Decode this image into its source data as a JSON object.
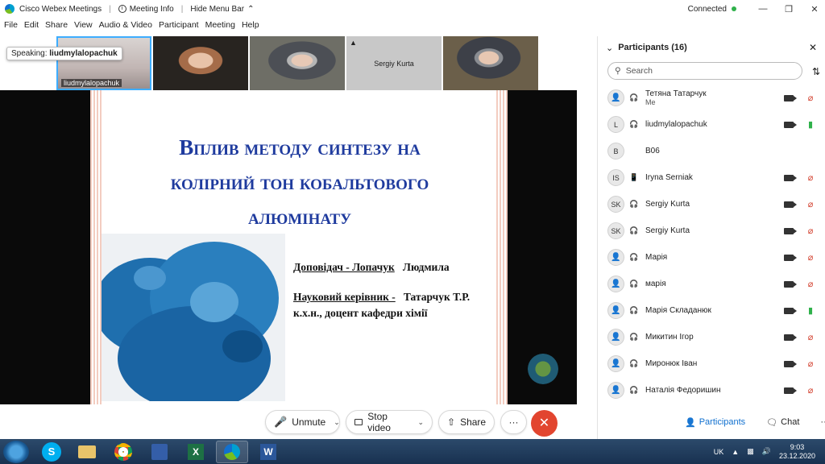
{
  "titlebar": {
    "app_title": "Cisco Webex Meetings",
    "meeting_info": "Meeting Info",
    "hide_menu": "Hide Menu Bar",
    "status": "Connected"
  },
  "menu": [
    "File",
    "Edit",
    "Share",
    "View",
    "Audio & Video",
    "Participant",
    "Meeting",
    "Help"
  ],
  "speaking": {
    "label": "Speaking:",
    "name": "liudmylalopachuk"
  },
  "tiles": [
    {
      "name": "liudmylalopachuk"
    },
    {
      "name": ""
    },
    {
      "name": ""
    },
    {
      "name": "Sergiy Kurta"
    },
    {
      "name": ""
    }
  ],
  "slide": {
    "title_lines": [
      "Вплив методу синтезу на",
      "колірний тон кобальтового",
      "алюмінату"
    ],
    "presenter_label": "Доповідач - Лопачук",
    "presenter_name": "Людмила",
    "supervisor_label": "Науковий керівник -",
    "supervisor_name": "Татарчук Т.Р.",
    "supervisor_title": "к.х.н., доцент кафедри хімії"
  },
  "controls": {
    "unmute": "Unmute",
    "stop_video": "Stop video",
    "share": "Share",
    "more": "···"
  },
  "panel": {
    "title": "Participants (16)",
    "search_placeholder": "Search",
    "participants": [
      {
        "initials": "",
        "name": "Тетяна Татарчук",
        "sub": "Me",
        "video": true,
        "mic": "muted",
        "device": "audio"
      },
      {
        "initials": "L",
        "name": "liudmylalopachuk",
        "sub": "",
        "video": true,
        "mic": "on",
        "device": "audio"
      },
      {
        "initials": "B",
        "name": "B06",
        "sub": "",
        "video": false,
        "mic": "none",
        "device": "none"
      },
      {
        "initials": "IS",
        "name": "Iryna Serniak",
        "sub": "",
        "video": true,
        "mic": "muted",
        "device": "phone"
      },
      {
        "initials": "SK",
        "name": "Sergiy Kurta",
        "sub": "",
        "video": true,
        "mic": "muted",
        "device": "audio"
      },
      {
        "initials": "SK",
        "name": "Sergiy Kurta",
        "sub": "",
        "video": true,
        "mic": "muted",
        "device": "audio"
      },
      {
        "initials": "",
        "name": "Марія",
        "sub": "",
        "video": true,
        "mic": "muted",
        "device": "audio"
      },
      {
        "initials": "",
        "name": "марія",
        "sub": "",
        "video": true,
        "mic": "muted",
        "device": "audio"
      },
      {
        "initials": "",
        "name": "Марія Складанюк",
        "sub": "",
        "video": true,
        "mic": "on",
        "device": "audio"
      },
      {
        "initials": "",
        "name": "Микитин Ігор",
        "sub": "",
        "video": true,
        "mic": "muted",
        "device": "audio"
      },
      {
        "initials": "",
        "name": "Миронюк Іван",
        "sub": "",
        "video": true,
        "mic": "muted",
        "device": "audio"
      },
      {
        "initials": "",
        "name": "Наталія Федоришин",
        "sub": "",
        "video": true,
        "mic": "muted",
        "device": "audio"
      }
    ],
    "footer": {
      "participants": "Participants",
      "chat": "Chat",
      "more": "···"
    }
  },
  "taskbar": {
    "apps": [
      "skype",
      "explorer",
      "chrome",
      "save",
      "excel",
      "webex",
      "word"
    ],
    "lang": "UK",
    "time": "9:03",
    "date": "23.12.2020"
  },
  "colors": {
    "accent": "#1170cf",
    "end": "#e2452f",
    "muted": "#d23d2b",
    "slide_title": "#1f3b9e"
  }
}
